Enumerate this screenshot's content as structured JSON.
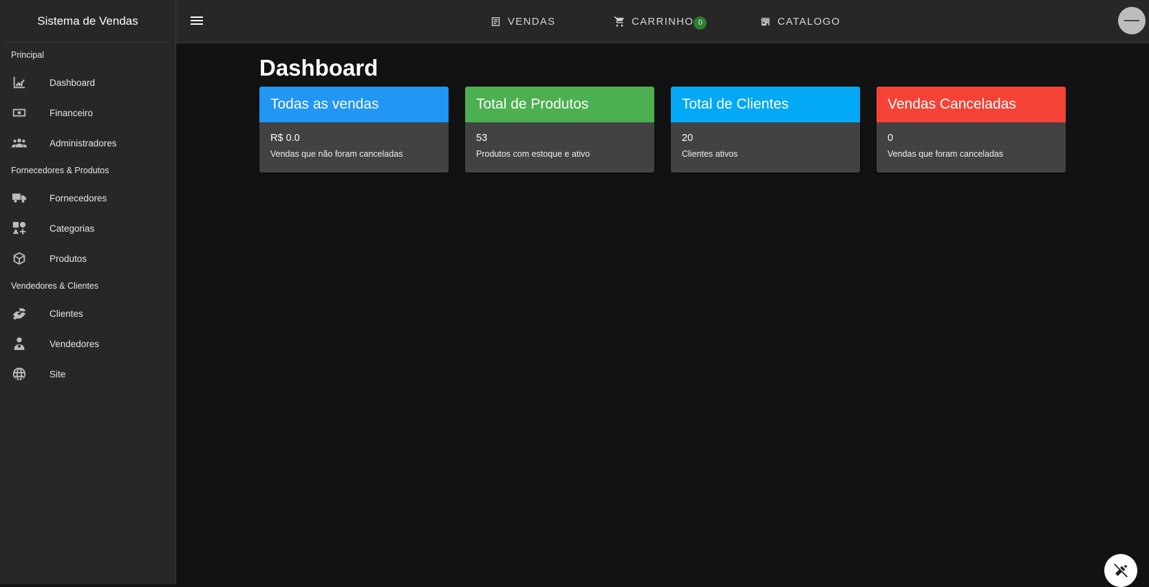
{
  "app": {
    "title": "Sistema de Vendas"
  },
  "sidebar": {
    "sections": [
      {
        "label": "Principal",
        "items": [
          {
            "label": "Dashboard",
            "icon": "chart-icon"
          },
          {
            "label": "Financeiro",
            "icon": "money-icon"
          },
          {
            "label": "Administradores",
            "icon": "group-icon"
          }
        ]
      },
      {
        "label": "Fornecedores & Produtos",
        "items": [
          {
            "label": "Fornecedores",
            "icon": "truck-icon"
          },
          {
            "label": "Categorias",
            "icon": "category-icon"
          },
          {
            "label": "Produtos",
            "icon": "package-icon"
          }
        ]
      },
      {
        "label": "Vendedores & Clientes",
        "items": [
          {
            "label": "Clientes",
            "icon": "handshake-icon"
          },
          {
            "label": "Vendedores",
            "icon": "seller-icon"
          },
          {
            "label": "Site",
            "icon": "globe-icon"
          }
        ]
      }
    ]
  },
  "topbar": {
    "nav": [
      {
        "label": "VENDAS",
        "icon": "receipt-icon"
      },
      {
        "label": "CARRINHO",
        "icon": "cart-icon",
        "badge": "0"
      },
      {
        "label": "CATALOGO",
        "icon": "store-icon"
      }
    ]
  },
  "main": {
    "title": "Dashboard",
    "cards": [
      {
        "title": "Todas as vendas",
        "value": "R$ 0.0",
        "description": "Vendas que não foram canceladas",
        "color": "#2196F3"
      },
      {
        "title": "Total de Produtos",
        "value": "53",
        "description": "Produtos com estoque e ativo",
        "color": "#4CAF50"
      },
      {
        "title": "Total de Clientes",
        "value": "20",
        "description": "Clientes ativos",
        "color": "#03A9F4"
      },
      {
        "title": "Vendas Canceladas",
        "value": "0",
        "description": "Vendas que foram canceladas",
        "color": "#F44336"
      }
    ]
  },
  "colors": {
    "background": "#121212",
    "surface": "#272727",
    "card_body": "#424242",
    "badge": "#2e7d32"
  }
}
